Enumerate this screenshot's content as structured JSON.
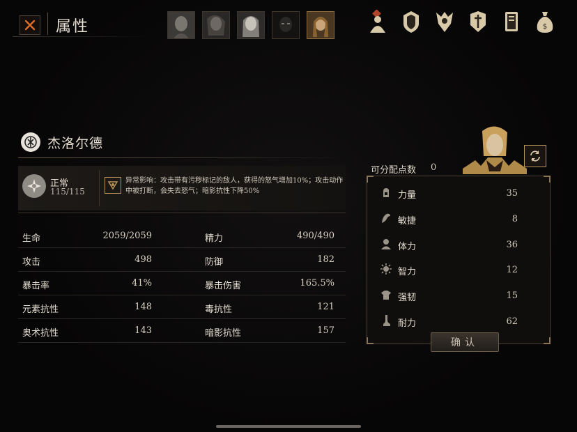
{
  "header": {
    "title": "属性"
  },
  "party": {
    "portraits": [
      {
        "name": "portrait-1"
      },
      {
        "name": "portrait-2"
      },
      {
        "name": "portrait-3"
      },
      {
        "name": "portrait-4"
      },
      {
        "name": "portrait-5"
      }
    ]
  },
  "top_icons": [
    "character-icon",
    "shield-icon",
    "crest-icon",
    "armor-icon",
    "book-icon",
    "bag-icon"
  ],
  "character": {
    "name": "杰洛尔德",
    "status": {
      "name": "正常",
      "value": "115/115",
      "effect": "异常影响：攻击带有污秽标记的敌人，获得的怒气增加10%；攻击动作中被打断，会失去怒气；暗影抗性下降50%"
    }
  },
  "stats": [
    {
      "l1": "生命",
      "v1": "2059/2059",
      "l2": "精力",
      "v2": "490/490"
    },
    {
      "l1": "攻击",
      "v1": "498",
      "l2": "防御",
      "v2": "182"
    },
    {
      "l1": "暴击率",
      "v1": "41%",
      "l2": "暴击伤害",
      "v2": "165.5%"
    },
    {
      "l1": "元素抗性",
      "v1": "148",
      "l2": "毒抗性",
      "v2": "121"
    },
    {
      "l1": "奥术抗性",
      "v1": "143",
      "l2": "暗影抗性",
      "v2": "157"
    }
  ],
  "points": {
    "label": "可分配点数",
    "value": "0"
  },
  "attributes": [
    {
      "label": "力量",
      "value": "35",
      "icon": "strength-icon"
    },
    {
      "label": "敏捷",
      "value": "8",
      "icon": "agility-icon"
    },
    {
      "label": "体力",
      "value": "36",
      "icon": "vitality-icon"
    },
    {
      "label": "智力",
      "value": "12",
      "icon": "intelligence-icon"
    },
    {
      "label": "强韧",
      "value": "15",
      "icon": "toughness-icon"
    },
    {
      "label": "耐力",
      "value": "62",
      "icon": "stamina-icon"
    }
  ],
  "confirm_label": "确认",
  "colors": {
    "gold": "#b89458",
    "panel": "#100e0c",
    "text": "#e2dbcf"
  }
}
